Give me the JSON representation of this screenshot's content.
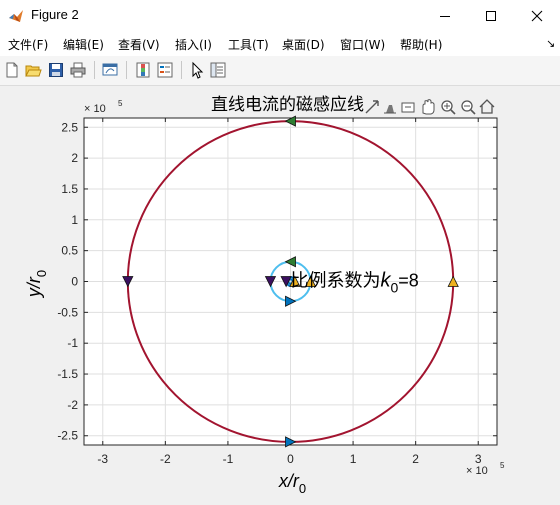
{
  "window": {
    "title": "Figure 2",
    "controls": {
      "minimize": "minimize-icon",
      "maximize": "maximize-icon",
      "close": "close-icon"
    }
  },
  "menubar": {
    "items": [
      {
        "label": "文件(F)"
      },
      {
        "label": "编辑(E)"
      },
      {
        "label": "查看(V)"
      },
      {
        "label": "插入(I)"
      },
      {
        "label": "工具(T)"
      },
      {
        "label": "桌面(D)"
      },
      {
        "label": "窗口(W)"
      },
      {
        "label": "帮助(H)"
      }
    ],
    "overflow_arrow": "↘"
  },
  "toolbar": {
    "icons": [
      "new-figure-icon",
      "open-file-icon",
      "save-icon",
      "print-icon",
      "link-plot-icon",
      "insert-colorbar-icon",
      "insert-legend-icon",
      "edit-plot-icon",
      "property-inspector-icon"
    ]
  },
  "axes_toolbar": {
    "icons": [
      "export-icon",
      "brush-icon",
      "data-tips-icon",
      "pan-icon",
      "zoom-in-icon",
      "zoom-out-icon",
      "home-icon"
    ]
  },
  "colors": {
    "large_circle": "#a2142f",
    "small_circle": "#4dbeee",
    "grid": "#dfdfdf",
    "axes_background": "#ffffff",
    "arrow_green": "#2e7d32",
    "arrow_blue": "#0072bd",
    "arrow_yellow": "#edb120",
    "arrow_purple": "#3b1060"
  },
  "chart_data": {
    "type": "line",
    "title": "直线电流的磁感应线",
    "xlabel": "x/r",
    "xlabel_sub": "0",
    "ylabel": "y/r",
    "ylabel_sub": "0",
    "x_exponent_base": "× 10",
    "x_exponent_power": "5",
    "y_exponent_base": "× 10",
    "y_exponent_power": "5",
    "xlim": [
      -3.3,
      3.3
    ],
    "ylim": [
      -2.65,
      2.65
    ],
    "xticks": [
      -3,
      -2,
      -1,
      0,
      1,
      2,
      3
    ],
    "yticks": [
      -2.5,
      -2,
      -1.5,
      -1,
      -0.5,
      0,
      0.5,
      1,
      1.5,
      2,
      2.5
    ],
    "xtick_labels": [
      "-3",
      "-2",
      "-1",
      "0",
      "1",
      "2",
      "3"
    ],
    "ytick_labels": [
      "-2.5",
      "-2",
      "-1.5",
      "-1",
      "-0.5",
      "0",
      "0.5",
      "1",
      "1.5",
      "2",
      "2.5"
    ],
    "grid": true,
    "annotation": {
      "text": "比例系数为",
      "k": "k",
      "k_sub": "0",
      "value": "=8",
      "x": 0,
      "y": 0
    },
    "series": [
      {
        "radius": 2.6,
        "color": "#a2142f"
      },
      {
        "radius": 0.32,
        "color": "#4dbeee"
      },
      {
        "radius": 0.07,
        "color": "#0072bd"
      },
      {
        "radius": 0.035,
        "color": "#0072bd"
      }
    ],
    "arrows": [
      {
        "x": 0,
        "y": 2.6,
        "dir": "left",
        "color": "#2e7d32"
      },
      {
        "x": -2.6,
        "y": 0,
        "dir": "down",
        "color": "#3b1060"
      },
      {
        "x": 0,
        "y": -2.6,
        "dir": "right",
        "color": "#0072bd"
      },
      {
        "x": 2.6,
        "y": 0,
        "dir": "up",
        "color": "#edb120"
      },
      {
        "x": 0,
        "y": 0.32,
        "dir": "left",
        "color": "#2e7d32"
      },
      {
        "x": -0.32,
        "y": 0,
        "dir": "down",
        "color": "#3b1060"
      },
      {
        "x": 0,
        "y": -0.32,
        "dir": "right",
        "color": "#0072bd"
      },
      {
        "x": 0.32,
        "y": 0,
        "dir": "up",
        "color": "#edb120"
      },
      {
        "x": 0.07,
        "y": 0,
        "dir": "up",
        "color": "#edb120"
      },
      {
        "x": -0.07,
        "y": 0,
        "dir": "down",
        "color": "#3b1060"
      }
    ]
  }
}
